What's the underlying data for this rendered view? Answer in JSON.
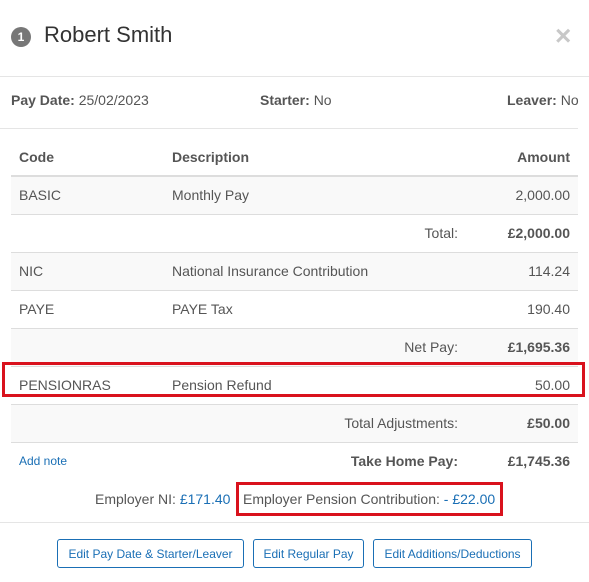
{
  "header": {
    "badge": "1",
    "name": "Robert Smith",
    "close": "×"
  },
  "meta": {
    "pay_date_label": "Pay Date:",
    "pay_date": "25/02/2023",
    "starter_label": "Starter:",
    "starter": "No",
    "leaver_label": "Leaver:",
    "leaver": "No"
  },
  "table": {
    "headers": {
      "code": "Code",
      "description": "Description",
      "amount": "Amount"
    },
    "basic": {
      "code": "BASIC",
      "description": "Monthly Pay",
      "amount": "2,000.00"
    },
    "total": {
      "label": "Total:",
      "amount": "£2,000.00"
    },
    "nic": {
      "code": "NIC",
      "description": "National Insurance Contribution",
      "amount": "114.24"
    },
    "paye": {
      "code": "PAYE",
      "description": "PAYE Tax",
      "amount": "190.40"
    },
    "net": {
      "label": "Net Pay:",
      "amount": "£1,695.36"
    },
    "pension": {
      "code": "PENSIONRAS",
      "description": "Pension Refund",
      "amount": "50.00"
    },
    "adjust": {
      "label": "Total Adjustments:",
      "amount": "£50.00"
    },
    "take_home": {
      "add_note": "Add note",
      "label": "Take Home Pay:",
      "amount": "£1,745.36"
    }
  },
  "footer": {
    "employer_ni_label": "Employer NI:",
    "employer_ni": "£171.40",
    "employer_pension_label": "Employer Pension Contribution:",
    "employer_pension": "- £22.00"
  },
  "buttons": {
    "edit_pay_date": "Edit Pay Date & Starter/Leaver",
    "edit_regular": "Edit Regular Pay",
    "edit_additions": "Edit Additions/Deductions"
  }
}
